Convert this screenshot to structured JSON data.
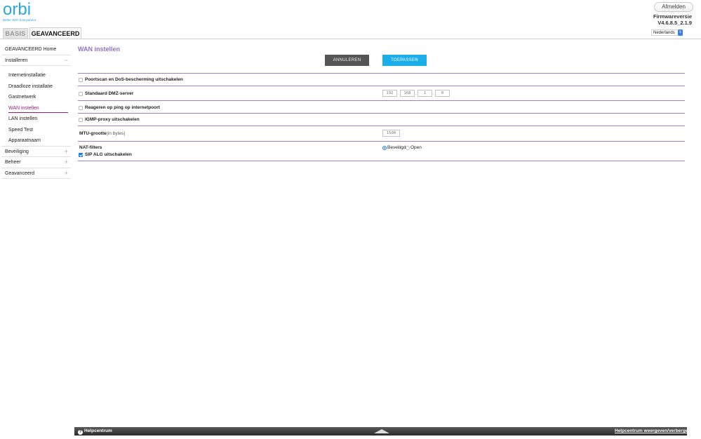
{
  "brand": {
    "name": "orbi",
    "tagline": "Better WiFi Everywhere"
  },
  "header": {
    "logout_label": "Afmelden",
    "firmware_label": "Firmwareversie",
    "firmware_value": "V4.6.8.5_2.1.9",
    "language": "Nederlands"
  },
  "tabs": [
    {
      "label": "BASIS",
      "active": false
    },
    {
      "label": "GEAVANCEERD",
      "active": true
    }
  ],
  "sidebar": {
    "home": "GEAVANCEERD Home",
    "installeren": "Installeren",
    "installeren_toggle": "−",
    "sub": [
      "Internetinstallatie",
      "Draadloze installatie",
      "Gastnetwerk",
      "WAN instellen",
      "LAN instellen",
      "Speed Test",
      "Apparaatnaam"
    ],
    "active_sub": "WAN instellen",
    "groups": [
      {
        "label": "Beveiliging",
        "toggle": "+"
      },
      {
        "label": "Beheer",
        "toggle": "+"
      },
      {
        "label": "Geavanceerd",
        "toggle": "+"
      }
    ]
  },
  "main": {
    "title": "WAN instellen",
    "cancel_label": "ANNULEREN",
    "apply_label": "TOEPASSEN",
    "portscan_label": "Poortscan en DoS-bescherming uitschakelen",
    "dmz_label": "Standaard DMZ-server",
    "dmz_ip": [
      "192",
      "168",
      "1",
      "0"
    ],
    "ping_label": "Reageren op ping op internetpoort",
    "igmp_label": "IGMP-proxy uitschakelen",
    "mtu_label": "MTU-grootte",
    "mtu_unit": "(in bytes)",
    "mtu_value": "1500",
    "nat_label": "NAT-filters",
    "nat_secure": "Beveiligd",
    "nat_open": "Open",
    "sip_label": "SIP ALG uitschakelen"
  },
  "footer": {
    "help_icon": "?",
    "help_label": "Helpcentrum",
    "toggle_label": "Helpcentrum weergeven/verbergen"
  },
  "colors": {
    "accent": "#9173c6",
    "apply": "#1caee8",
    "active_nav": "#8e1f7f"
  }
}
